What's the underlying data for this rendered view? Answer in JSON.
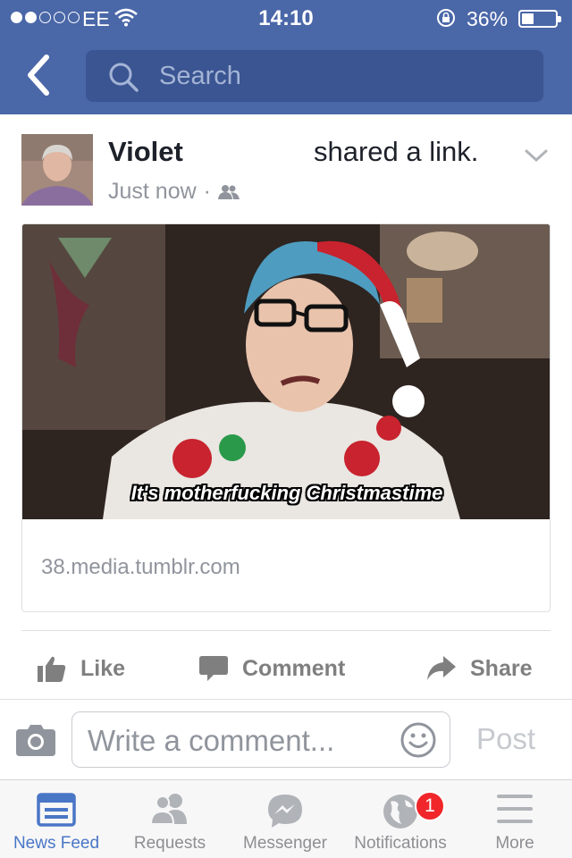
{
  "status_bar": {
    "carrier": "EE",
    "time": "14:10",
    "battery_percent": "36%",
    "battery_level": 0.36,
    "signal_bars_filled": 2,
    "signal_bars_total": 5
  },
  "nav": {
    "search_placeholder": "Search"
  },
  "post": {
    "author": "Violet",
    "action": "shared a link.",
    "timestamp": "Just now",
    "audience_icon": "friends-icon",
    "media_caption": "It's motherfucking Christmastime",
    "link_domain": "38.media.tumblr.com"
  },
  "actions": {
    "like": "Like",
    "comment": "Comment",
    "share": "Share"
  },
  "comment_box": {
    "placeholder": "Write a comment...",
    "post_label": "Post"
  },
  "tabs": [
    {
      "label": "News Feed",
      "icon": "news-feed-icon",
      "active": true
    },
    {
      "label": "Requests",
      "icon": "requests-icon",
      "active": false
    },
    {
      "label": "Messenger",
      "icon": "messenger-icon",
      "active": false
    },
    {
      "label": "Notifications",
      "icon": "globe-icon",
      "active": false,
      "badge": "1"
    },
    {
      "label": "More",
      "icon": "menu-icon",
      "active": false
    }
  ],
  "colors": {
    "brand_blue": "#4a67a8",
    "active_tab": "#4a76c6",
    "badge_red": "#f0262a"
  }
}
